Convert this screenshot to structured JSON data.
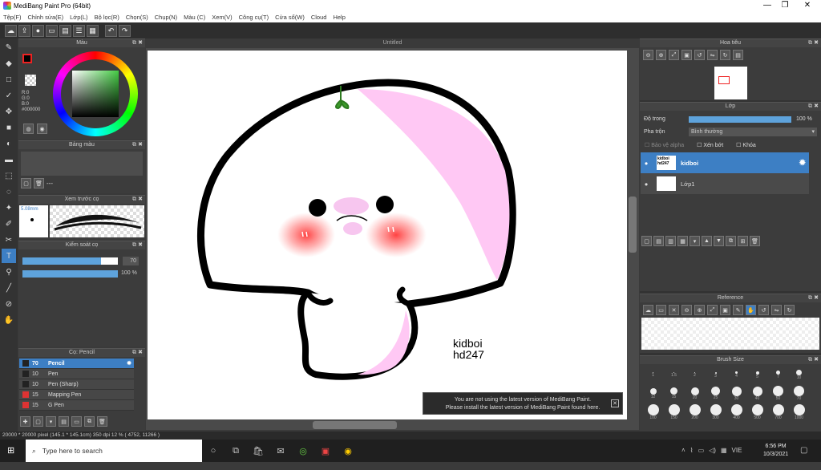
{
  "window": {
    "title": "MediBang Paint Pro (64bit)",
    "minimize": "—",
    "maximize": "❐",
    "close": "✕"
  },
  "menu": [
    "Tệp(F)",
    "Chỉnh sửa(E)",
    "Lớp(L)",
    "Bộ lọc(R)",
    "Chọn(S)",
    "Chụp(N)",
    "Màu (C)",
    "Xem(V)",
    "Công cụ(T)",
    "Cửa sổ(W)",
    "Cloud",
    "Help"
  ],
  "document": {
    "tab": "Untitled",
    "caption_line1": "kidboi",
    "caption_line2": "hd247"
  },
  "color_panel": {
    "title": "Màu",
    "r": "R:0",
    "g": "G:0",
    "b": "B:0",
    "hex": "#000000"
  },
  "palette_panel": {
    "title": "Bảng màu",
    "empty": "---"
  },
  "brush_preview": {
    "title": "Xem trước cọ",
    "size": "5.08mm"
  },
  "brush_control": {
    "title": "Kiểm soát cọ",
    "size_value": "70",
    "opacity_value": "100 %",
    "size_fill": 0.82,
    "opacity_fill": 1.0
  },
  "brush_panel": {
    "title": "Cọ: Pencil",
    "items": [
      {
        "size": "70",
        "name": "Pencil",
        "color": "#222222"
      },
      {
        "size": "10",
        "name": "Pen",
        "color": "#222222"
      },
      {
        "size": "10",
        "name": "Pen (Sharp)",
        "color": "#222222"
      },
      {
        "size": "15",
        "name": "Mapping Pen",
        "color": "#dd3333"
      },
      {
        "size": "15",
        "name": "G Pen",
        "color": "#dd3333"
      }
    ]
  },
  "navigator": {
    "title": "Hoa tiêu"
  },
  "layer_panel": {
    "title": "Lớp",
    "opacity_label": "Độ trong",
    "opacity_value": "100 %",
    "blend_label": "Pha trộn",
    "blend_value": "Bình thường",
    "protect_alpha": "Bảo vệ alpha",
    "clipping": "Xén bớt",
    "lock": "Khóa",
    "layers": [
      {
        "name": "kidboi",
        "thumb": "kidboi hd247"
      },
      {
        "name": "Lớp1",
        "thumb": ""
      }
    ]
  },
  "reference": {
    "title": "Reference"
  },
  "brush_size": {
    "title": "Brush Size",
    "sizes": [
      "1",
      "1.5",
      "2",
      "3",
      "4",
      "5",
      "7",
      "10",
      "12",
      "15",
      "20",
      "25",
      "30",
      "40",
      "50",
      "70",
      "100",
      "150",
      "200",
      "300",
      "400",
      "500",
      "700",
      "1000"
    ]
  },
  "notice": {
    "line1": "You are not using the latest version of MediBang Paint.",
    "line2": "Please install the latest version of MediBang Paint found here."
  },
  "status": "20000 * 20000 pixel  (145.1 * 145.1cm)  350 dpi  12 %  ( 4752, 11266 )",
  "taskbar": {
    "search_placeholder": "Type here to search",
    "lang": "VIE",
    "time": "6:56 PM",
    "date": "10/3/2021"
  }
}
